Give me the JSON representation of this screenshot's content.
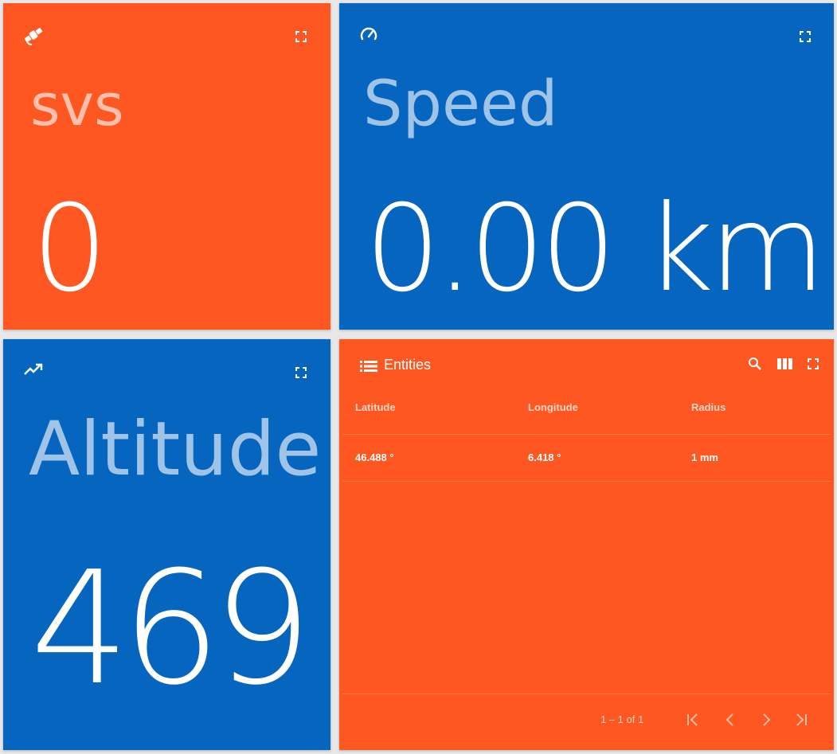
{
  "svs_card": {
    "label": "svs",
    "value": "0",
    "icon": "satellite-icon",
    "color": "#FF5722"
  },
  "speed_card": {
    "label": "Speed",
    "value": "0.00 km",
    "icon": "speedometer-icon",
    "color": "#0565BF"
  },
  "altitude_card": {
    "label": "Altitude",
    "value": "469",
    "icon": "trending-up-icon",
    "color": "#0565BF"
  },
  "entities_card": {
    "title": "Entities",
    "icon": "list-icon",
    "color": "#FF5722",
    "columns": [
      "Latitude",
      "Longitude",
      "Radius"
    ],
    "rows": [
      [
        "46.488 °",
        "6.418 °",
        "1 mm"
      ]
    ],
    "pagination": "1 – 1 of 1"
  }
}
